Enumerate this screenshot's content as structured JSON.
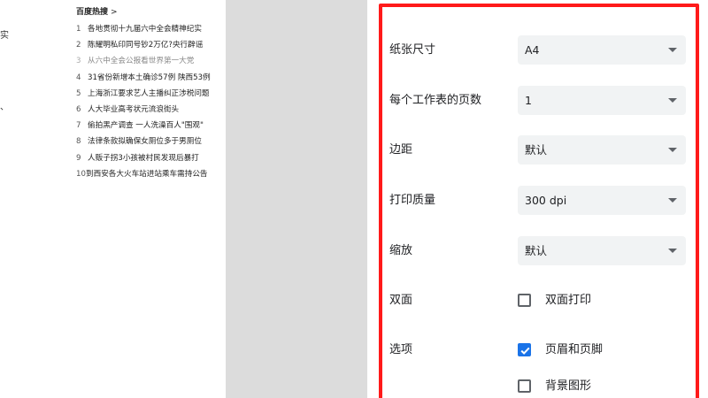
{
  "preview": {
    "fragments": [
      "实",
      "、"
    ],
    "hot": {
      "title": "百度热搜",
      "chevron": ">",
      "items": [
        {
          "num": "1",
          "text": "各地贯彻十九届六中全会精神纪实"
        },
        {
          "num": "2",
          "text": "陈耀明私印同号钞2万亿?央行辟谣"
        },
        {
          "num": "3",
          "text": "从六中全会公报看世界第一大党"
        },
        {
          "num": "4",
          "text": "31省份新增本土确诊57例 陕西53例"
        },
        {
          "num": "5",
          "text": "上海浙江要求艺人主播纠正涉税问题"
        },
        {
          "num": "6",
          "text": "人大毕业高考状元流浪街头"
        },
        {
          "num": "7",
          "text": "偷拍黑产调查 一人洗澡百人\"围观\""
        },
        {
          "num": "8",
          "text": "法律条款拟确保女厕位多于男厕位"
        },
        {
          "num": "9",
          "text": "人贩子拐3小孩被村民发现后暴打"
        },
        {
          "num": "10",
          "text": "到西安各大火车站进站乘车需持公告"
        }
      ]
    }
  },
  "settings": {
    "paper_size": {
      "label": "纸张尺寸",
      "value": "A4"
    },
    "pages_per_sheet": {
      "label": "每个工作表的页数",
      "value": "1"
    },
    "margins": {
      "label": "边距",
      "value": "默认"
    },
    "quality": {
      "label": "打印质量",
      "value": "300 dpi"
    },
    "scale": {
      "label": "缩放",
      "value": "默认"
    },
    "duplex": {
      "label": "双面",
      "option": "双面打印",
      "checked": false
    },
    "options": {
      "label": "选项",
      "items": [
        {
          "label": "页眉和页脚",
          "checked": true
        },
        {
          "label": "背景图形",
          "checked": false
        }
      ]
    }
  },
  "colors": {
    "accent": "#1a73e8",
    "highlight": "#ff1a1a",
    "gutter": "#dcdcdc",
    "select_bg": "#f1f3f4"
  }
}
